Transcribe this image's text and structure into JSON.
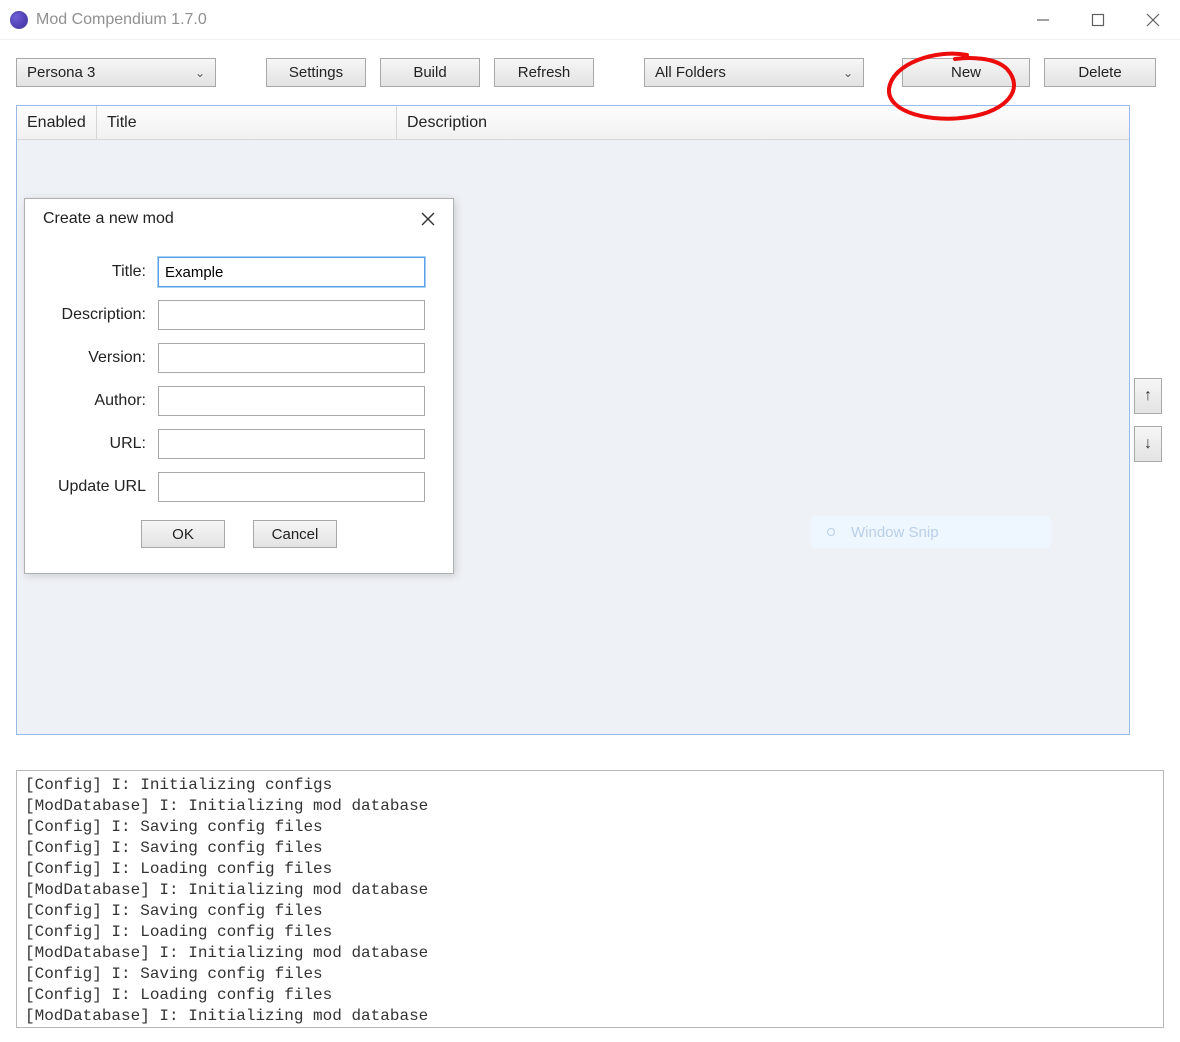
{
  "window": {
    "title": "Mod Compendium 1.7.0"
  },
  "toolbar": {
    "game_dropdown": "Persona 3",
    "settings_label": "Settings",
    "build_label": "Build",
    "refresh_label": "Refresh",
    "folders_dropdown": "All Folders",
    "new_label": "New",
    "delete_label": "Delete"
  },
  "table": {
    "headers": {
      "enabled": "Enabled",
      "title": "Title",
      "description": "Description"
    }
  },
  "side_arrows": {
    "up": "↑",
    "down": "↓"
  },
  "dialog": {
    "title": "Create a new mod",
    "fields": {
      "title_label": "Title:",
      "title_value": "Example",
      "description_label": "Description:",
      "description_value": "",
      "version_label": "Version:",
      "version_value": "",
      "author_label": "Author:",
      "author_value": "",
      "url_label": "URL:",
      "url_value": "",
      "updateurl_label": "Update URL",
      "updateurl_value": ""
    },
    "ok_label": "OK",
    "cancel_label": "Cancel"
  },
  "snip": {
    "label": "Window Snip"
  },
  "log_lines": [
    "[Config] I: Initializing configs",
    "[ModDatabase] I: Initializing mod database",
    "[Config] I: Saving config files",
    "[Config] I: Saving config files",
    "[Config] I: Loading config files",
    "[ModDatabase] I: Initializing mod database",
    "[Config] I: Saving config files",
    "[Config] I: Loading config files",
    "[ModDatabase] I: Initializing mod database",
    "[Config] I: Saving config files",
    "[Config] I: Loading config files",
    "[ModDatabase] I: Initializing mod database"
  ]
}
